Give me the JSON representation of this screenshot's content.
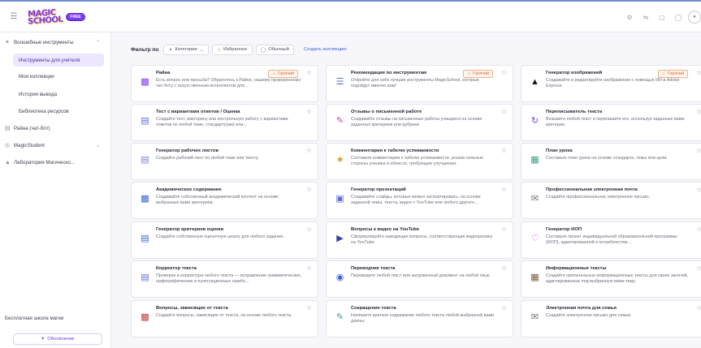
{
  "app": {
    "logo_line1": "MAGIC",
    "logo_line2": "SCHOOL",
    "plan_badge": "FREE"
  },
  "topbar": {
    "icons": [
      "gear-icon",
      "translate-icon",
      "chat-icon",
      "help-icon",
      "user-icon"
    ]
  },
  "sidebar": {
    "sections": [
      {
        "label": "Волшебные инструменты",
        "icon": "magic-wand-icon",
        "expanded": true
      },
      {
        "label": "Райна (чат-бот)",
        "icon": "chat-bot-icon"
      },
      {
        "label": "MagicStudent",
        "icon": "student-icon",
        "expanded": false
      },
      {
        "label": "Лаборатория Магическо...",
        "icon": "lab-icon"
      }
    ],
    "items": [
      {
        "label": "Инструменты для учителя",
        "active": true
      },
      {
        "label": "Мои коллекции"
      },
      {
        "label": "История вывода"
      },
      {
        "label": "Библиотека ресурсов"
      }
    ],
    "footer_title": "Бесплатная школа магии",
    "upgrade_label": "Обновление"
  },
  "filters": {
    "label": "Фильтр по",
    "categories": "Категории",
    "favorites": "Избранное",
    "ordinary": "Обычный",
    "create": "Создать коллекцию"
  },
  "hot_label": "Горячий",
  "cards": [
    {
      "title": "Райна",
      "desc": "Есть вопрос или просьба? Обратитесь к Райне, нашему проверенному чат-боту с искусственным интеллектом для...",
      "hot": true,
      "icon": "robot-icon",
      "icon_color": "#7a3cf0"
    },
    {
      "title": "Рекомендации по инструментам",
      "desc": "Откройте для себя лучшие инструменты MagicSchool, которые подойдут именно вам!",
      "hot": true,
      "icon": "stack-icon",
      "icon_color": "#5b6cd6"
    },
    {
      "title": "Генератор изображений",
      "desc": "Создавайте и редактируйте изображения с помощью ИИ в Adobe Express.",
      "hot": true,
      "icon": "adobe-icon",
      "icon_color": "#1a1a1a"
    },
    {
      "title": "Тест с вариантами ответов / Оценка",
      "desc": "Создайте тест, викторину или контрольную работу с вариантами ответов по любой теме, стандарту(ам) или...",
      "hot": false,
      "icon": "quiz-icon",
      "icon_color": "#5b6cd6"
    },
    {
      "title": "Отзывы о письменной работе",
      "desc": "Создавайте отзывы на письменные работы учащихся на основе заданных критериев или рубрики.",
      "hot": false,
      "icon": "pen-icon",
      "icon_color": "#c23fbf"
    },
    {
      "title": "Переписыватель текста",
      "desc": "Возьмите любой текст и перепишите его, используя заданные вами критерии.",
      "hot": false,
      "icon": "rewrite-icon",
      "icon_color": "#7a3cf0"
    },
    {
      "title": "Генератор рабочих листов",
      "desc": "Создайте рабочий лист по любой теме или тексту.",
      "hot": false,
      "icon": "worksheet-icon",
      "icon_color": "#7a7fd6"
    },
    {
      "title": "Комментарии к табелю успеваемости",
      "desc": "Составьте комментарии к табелю успеваемости, указав сильные стороны ученика и области, требующие улучшения.",
      "hot": false,
      "icon": "report-card-icon",
      "icon_color": "#d8a12a"
    },
    {
      "title": "План урока",
      "desc": "Составьте план урока на основе стандарта, темы или цели.",
      "hot": false,
      "icon": "lesson-plan-icon",
      "icon_color": "#3fa07a"
    },
    {
      "title": "Академическое содержание",
      "desc": "Создавайте собственный академический контент на основе выбранных вами критериев.",
      "hot": false,
      "icon": "academic-icon",
      "icon_color": "#3b62d8"
    },
    {
      "title": "Генератор презентаций",
      "desc": "Создавайте слайды, которые можно экспортировать, на основе заданной темы, текста, видео с YouTube или любого другого...",
      "hot": false,
      "icon": "presentation-icon",
      "icon_color": "#5b6cd6"
    },
    {
      "title": "Профессиональная электронная почта",
      "desc": "Создайте профессиональное электронное письмо.",
      "hot": false,
      "icon": "email-icon",
      "icon_color": "#6b6f7c"
    },
    {
      "title": "Генератор критериев оценки",
      "desc": "Создайте собственную оценочную шкалу для любого задания.",
      "hot": false,
      "icon": "rubric-icon",
      "icon_color": "#3b62d8"
    },
    {
      "title": "Вопросы к видео на YouTube",
      "desc": "Сформулируйте наводящие вопросы, соответствующие видеоролику на YouTube.",
      "hot": false,
      "icon": "video-icon",
      "icon_color": "#3b3fa0"
    },
    {
      "title": "Генератор ИОП",
      "desc": "Составьте проект индивидуальной образовательной программы (ИОП), адаптированной к потребностям...",
      "hot": false,
      "icon": "iep-icon",
      "icon_color": "#c23fbf"
    },
    {
      "title": "Корректор текста",
      "desc": "Проверка и корректура любого текста — исправление грамматических, орфографических и пунктуационных ошибо...",
      "hot": false,
      "icon": "proofread-icon",
      "icon_color": "#5b6cd6"
    },
    {
      "title": "Переводчик текста",
      "desc": "Переведите любой текст или загруженный документ на любой язык.",
      "hot": false,
      "icon": "globe-icon",
      "icon_color": "#3b62d8"
    },
    {
      "title": "Информационные тексты",
      "desc": "Создайте оригинальные информационные тексты для своих занятий, адаптированные под выбранную вами тему.",
      "hot": false,
      "icon": "library-icon",
      "icon_color": "#7a5a3a"
    },
    {
      "title": "Вопросы, зависящие от текста",
      "desc": "Создайте вопросы, зависящие от текста, на основе любого текста.",
      "hot": false,
      "icon": "questions-icon",
      "icon_color": "#c23f3f"
    },
    {
      "title": "Сокращение текста",
      "desc": "Напишите краткое содержание любого текста любой выбранной вами длины.",
      "hot": false,
      "icon": "summarize-icon",
      "icon_color": "#3fa07a"
    },
    {
      "title": "Электронная почта для семьи",
      "desc": "Создайте электронное письмо для семьи.",
      "hot": false,
      "icon": "family-email-icon",
      "icon_color": "#6b6f7c"
    }
  ]
}
